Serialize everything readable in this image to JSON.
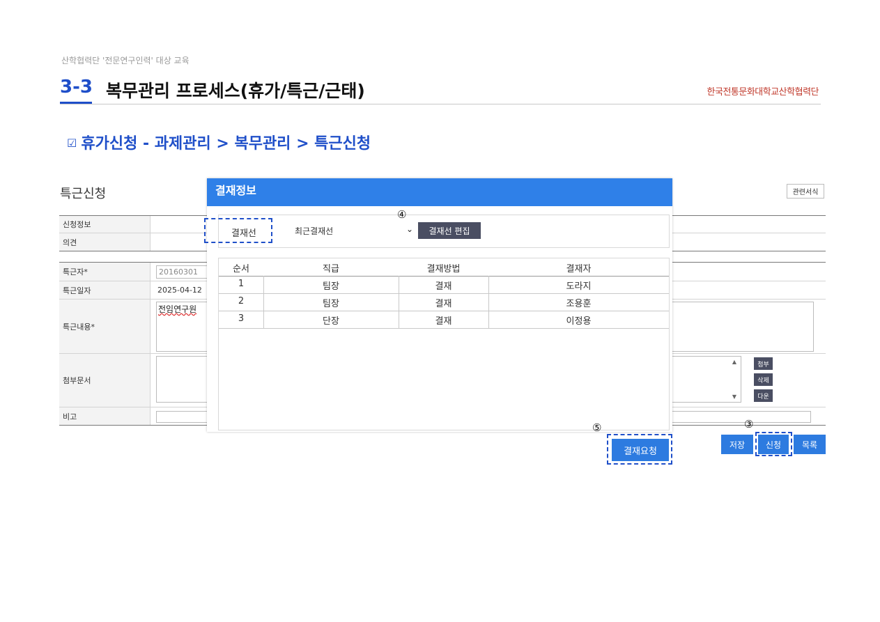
{
  "slide": {
    "caption": "산학협력단 '전문연구인력' 대상 교육",
    "section_number": "3-3",
    "section_title": "복무관리 프로세스(휴가/특근/근태)",
    "brand": "한국전통문화대학교산학협력단",
    "subheading_icon": "checkbox-icon",
    "subheading": "휴가신청 - 과제관리 > 복무관리 > 특근신청"
  },
  "form": {
    "title": "특근신청",
    "related_forms_button": "관련서식",
    "labels": {
      "application_info": "신청정보",
      "opinion": "의견",
      "worker": "특근자*",
      "work_date": "특근일자",
      "work_content": "특근내용*",
      "attachments": "첨부문서",
      "remarks": "비고"
    },
    "worker_value": "20160301",
    "work_date_value": "2025-04-12",
    "work_content_value": "전임연구원",
    "attach_buttons": {
      "attach": "첨부",
      "delete": "삭제",
      "download": "다운"
    },
    "actions": {
      "save": "저장",
      "apply": "신청",
      "list": "목록"
    }
  },
  "modal": {
    "title": "결재정보",
    "approval_line_label": "결재선",
    "approval_line_selected": "최근결재선",
    "edit_button": "결재선 편집",
    "table": {
      "headers": [
        "순서",
        "직급",
        "결재방법",
        "결재자"
      ],
      "rows": [
        [
          "1",
          "팀장",
          "결재",
          "도라지"
        ],
        [
          "2",
          "팀장",
          "결재",
          "조용훈"
        ],
        [
          "3",
          "단장",
          "결재",
          "이정용"
        ]
      ]
    },
    "request_button": "결재요청"
  },
  "markers": {
    "apply": "③",
    "edit": "④",
    "request": "⑤"
  },
  "colors": {
    "accent": "#1f4fc9",
    "modal_header": "#2f80e8",
    "button_blue": "#2d7be0",
    "dark_button": "#4a4e62",
    "brand": "#c0392b"
  }
}
